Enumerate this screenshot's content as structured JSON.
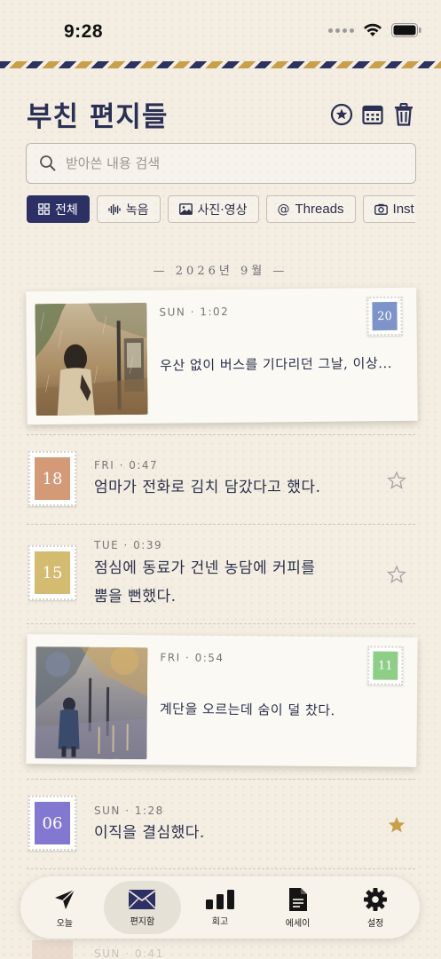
{
  "status_bar": {
    "time": "9:28"
  },
  "header": {
    "title": "부친 편지들",
    "icons": [
      "star-circle-icon",
      "calendar-icon",
      "trash-icon"
    ]
  },
  "search": {
    "placeholder": "받아쓴 내용 검색"
  },
  "filters": [
    {
      "label": "전체",
      "icon": "grid-icon",
      "active": true
    },
    {
      "label": "녹음",
      "icon": "waveform-icon",
      "active": false
    },
    {
      "label": "사진·영상",
      "icon": "image-icon",
      "active": false
    },
    {
      "label": "Threads",
      "icon": "at-icon",
      "active": false
    },
    {
      "label": "Inst",
      "icon": "camera-icon",
      "active": false
    }
  ],
  "month_label": "— 2026년 9월 —",
  "entries": [
    {
      "meta": "SUN · 1:02",
      "text": "우산 없이 버스를 기다리던 그날, 이상...",
      "stamp": "20",
      "stamp_color": "#7d93c9",
      "has_photo": true
    },
    {
      "meta": "FRI · 0:47",
      "text": "엄마가 전화로 김치 담갔다고 했다.",
      "stamp": "18",
      "stamp_color": "#d49a78",
      "starred": false
    },
    {
      "meta": "TUE · 0:39",
      "text_line1": "점심에 동료가 건넨 농담에 커피를",
      "text_line2": "뿜을 뻔했다.",
      "stamp": "15",
      "stamp_color": "#d3bc6f",
      "starred": false
    },
    {
      "meta": "FRI · 0:54",
      "text": "계단을 오르는데 숨이 덜 찼다.",
      "stamp": "11",
      "stamp_color": "#8fce87",
      "has_photo": true
    },
    {
      "meta": "SUN · 1:28",
      "text": "이직을 결심했다.",
      "stamp": "06",
      "stamp_color": "#8378d1",
      "starred": true
    },
    {
      "meta": "SUN · 0:41"
    }
  ],
  "colors": {
    "accent": "#2c3064",
    "star_filled": "#c9a04a",
    "star_empty": "#a8a6a8"
  },
  "tabbar": [
    {
      "label": "오늘",
      "icon": "paper-plane-icon"
    },
    {
      "label": "편지함",
      "icon": "envelope-icon",
      "active": true
    },
    {
      "label": "회고",
      "icon": "bar-chart-icon"
    },
    {
      "label": "에세이",
      "icon": "document-icon"
    },
    {
      "label": "설정",
      "icon": "gear-icon"
    }
  ]
}
